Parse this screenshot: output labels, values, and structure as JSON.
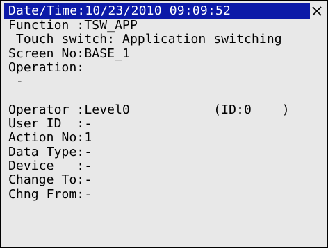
{
  "titlebar": {
    "text": "Date/Time:10/23/2010 09:09:52"
  },
  "lines": [
    "Function :TSW_APP",
    " Touch switch: Application switching",
    "Screen No:BASE_1",
    "Operation:",
    " -",
    "",
    "Operator :Level0           (ID:0    )",
    "User ID  :-",
    "Action No:1",
    "Data Type:-",
    "Device   :-",
    "Change To:-",
    "Chng From:-"
  ],
  "colors": {
    "titlebar_bg": "#0c1aa8",
    "window_bg": "#e8e8e8"
  },
  "icons": {
    "close": "close-icon"
  }
}
